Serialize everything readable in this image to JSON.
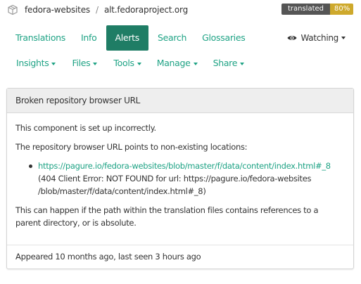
{
  "breadcrumb": {
    "project": "fedora-websites",
    "separator": "/",
    "component": "alt.fedoraproject.org"
  },
  "badge": {
    "label": "translated",
    "value": "80%",
    "color": "#cea92c"
  },
  "tabs": [
    {
      "label": "Translations",
      "active": false
    },
    {
      "label": "Info",
      "active": false
    },
    {
      "label": "Alerts",
      "active": true
    },
    {
      "label": "Search",
      "active": false
    },
    {
      "label": "Glossaries",
      "active": false
    }
  ],
  "watching": {
    "label": "Watching",
    "icon": "eye-icon"
  },
  "menus": [
    {
      "label": "Insights"
    },
    {
      "label": "Files"
    },
    {
      "label": "Tools"
    },
    {
      "label": "Manage"
    },
    {
      "label": "Share"
    }
  ],
  "alert": {
    "title": "Broken repository browser URL",
    "intro": "This component is set up incorrectly.",
    "lead": "The repository browser URL points to non-existing locations:",
    "items": [
      {
        "url": "https://pagure.io/fedora-websites/blob/master/f/data/content/index.html#_8",
        "error_line1": "(404 Client Error: NOT FOUND for url: https://pagure.io/fedora-websites",
        "error_line2": "/blob/master/f/data/content/index.html#_8)"
      }
    ],
    "hint": "This can happen if the path within the translation files contains references to a parent directory, or is absolute.",
    "footer": {
      "appeared_prefix": "Appeared",
      "appeared_when": "10 months ago",
      "seen_prefix": ", last seen",
      "seen_when": "3 hours ago"
    }
  },
  "colors": {
    "accent": "#1fa385",
    "active_tab": "#1f7d65",
    "badge_dark": "#555555"
  }
}
